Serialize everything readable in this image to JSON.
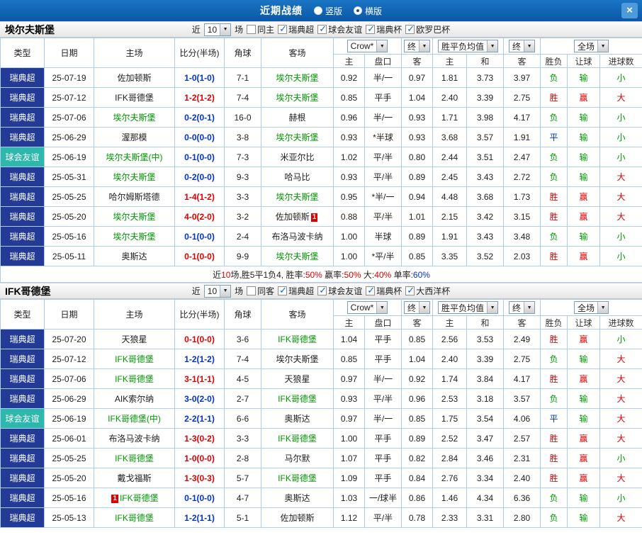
{
  "titlebar": {
    "title": "近期战绩",
    "radios": [
      {
        "label": "竖版",
        "selected": false
      },
      {
        "label": "横版",
        "selected": true
      }
    ],
    "close": "×"
  },
  "columns": {
    "type": "类型",
    "date": "日期",
    "home": "主场",
    "score": "比分(半场)",
    "corner": "角球",
    "away": "客场",
    "sub": [
      "主",
      "盘口",
      "客",
      "主",
      "和",
      "客",
      "胜负",
      "让球",
      "进球数"
    ]
  },
  "colors": {
    "topbar": "#0e62ae",
    "league_navy": "#233a97",
    "friendly_teal": "#2eb8ad",
    "win_red": "#dd0000",
    "loss_green": "#009900",
    "draw_blue": "#0033cc",
    "grid_line": "#aecdea"
  },
  "sections": [
    {
      "team": "埃尔夫斯堡",
      "filter": {
        "prefix": "近",
        "count": "10",
        "suffix": "场",
        "same": {
          "label": "同主",
          "checked": false
        },
        "comps": [
          {
            "label": "瑞典超",
            "checked": true
          },
          {
            "label": "球会友谊",
            "checked": true
          },
          {
            "label": "瑞典杯",
            "checked": true
          },
          {
            "label": "欧罗巴杯",
            "checked": true
          }
        ]
      },
      "dropdowns": {
        "company": "Crow*",
        "final1": "终",
        "avg": "胜平负均值",
        "final2": "终",
        "scope": "全场"
      },
      "rows": [
        {
          "type": "瑞典超",
          "tcls": "lg-a",
          "date": "25-07-19",
          "home": {
            "n": "佐加顿斯"
          },
          "score": {
            "t": "1-0(1-0)",
            "c": "b"
          },
          "corner": "7-1",
          "away": {
            "n": "埃尔夫斯堡",
            "g": true
          },
          "o1": "0.92",
          "hc": "半/一",
          "o2": "0.97",
          "m1": "1.81",
          "m2": "3.73",
          "m3": "3.97",
          "r1": [
            "负",
            "g"
          ],
          "r2": [
            "输",
            "g"
          ],
          "r3": [
            "小",
            "g"
          ]
        },
        {
          "type": "瑞典超",
          "tcls": "lg-a",
          "date": "25-07-12",
          "home": {
            "n": "IFK哥德堡"
          },
          "score": {
            "t": "1-2(1-2)",
            "c": "r"
          },
          "corner": "7-4",
          "away": {
            "n": "埃尔夫斯堡",
            "g": true
          },
          "o1": "0.85",
          "hc": "平手",
          "o2": "1.04",
          "m1": "2.40",
          "m2": "3.39",
          "m3": "2.75",
          "r1": [
            "胜",
            "r"
          ],
          "r2": [
            "赢",
            "r"
          ],
          "r3": [
            "大",
            "r"
          ]
        },
        {
          "type": "瑞典超",
          "tcls": "lg-a",
          "date": "25-07-06",
          "home": {
            "n": "埃尔夫斯堡",
            "g": true
          },
          "score": {
            "t": "0-2(0-1)",
            "c": "b"
          },
          "corner": "16-0",
          "away": {
            "n": "赫根"
          },
          "o1": "0.96",
          "hc": "半/一",
          "o2": "0.93",
          "m1": "1.71",
          "m2": "3.98",
          "m3": "4.17",
          "r1": [
            "负",
            "g"
          ],
          "r2": [
            "输",
            "g"
          ],
          "r3": [
            "小",
            "g"
          ]
        },
        {
          "type": "瑞典超",
          "tcls": "lg-a",
          "date": "25-06-29",
          "home": {
            "n": "渥那模"
          },
          "score": {
            "t": "0-0(0-0)",
            "c": "b"
          },
          "corner": "3-8",
          "away": {
            "n": "埃尔夫斯堡",
            "g": true
          },
          "o1": "0.93",
          "hc": "*半球",
          "o2": "0.93",
          "m1": "3.68",
          "m2": "3.57",
          "m3": "1.91",
          "r1": [
            "平",
            "b"
          ],
          "r2": [
            "输",
            "g"
          ],
          "r3": [
            "小",
            "g"
          ]
        },
        {
          "type": "球会友谊",
          "tcls": "lg-b",
          "date": "25-06-19",
          "home": {
            "n": "埃尔夫斯堡(中)",
            "g": true
          },
          "score": {
            "t": "0-1(0-0)",
            "c": "b"
          },
          "corner": "7-3",
          "away": {
            "n": "米亚尔比"
          },
          "o1": "1.02",
          "hc": "平/半",
          "o2": "0.80",
          "m1": "2.44",
          "m2": "3.51",
          "m3": "2.47",
          "r1": [
            "负",
            "g"
          ],
          "r2": [
            "输",
            "g"
          ],
          "r3": [
            "小",
            "g"
          ]
        },
        {
          "type": "瑞典超",
          "tcls": "lg-a",
          "date": "25-05-31",
          "home": {
            "n": "埃尔夫斯堡",
            "g": true
          },
          "score": {
            "t": "0-2(0-0)",
            "c": "b"
          },
          "corner": "9-3",
          "away": {
            "n": "哈马比"
          },
          "o1": "0.93",
          "hc": "平/半",
          "o2": "0.89",
          "m1": "2.45",
          "m2": "3.43",
          "m3": "2.72",
          "r1": [
            "负",
            "g"
          ],
          "r2": [
            "输",
            "g"
          ],
          "r3": [
            "大",
            "r"
          ]
        },
        {
          "type": "瑞典超",
          "tcls": "lg-a",
          "date": "25-05-25",
          "home": {
            "n": "哈尔姆斯塔德"
          },
          "score": {
            "t": "1-4(1-2)",
            "c": "r"
          },
          "corner": "3-3",
          "away": {
            "n": "埃尔夫斯堡",
            "g": true
          },
          "o1": "0.95",
          "hc": "*半/一",
          "o2": "0.94",
          "m1": "4.48",
          "m2": "3.68",
          "m3": "1.73",
          "r1": [
            "胜",
            "r"
          ],
          "r2": [
            "赢",
            "r"
          ],
          "r3": [
            "大",
            "r"
          ]
        },
        {
          "type": "瑞典超",
          "tcls": "lg-a",
          "date": "25-05-20",
          "home": {
            "n": "埃尔夫斯堡",
            "g": true
          },
          "score": {
            "t": "4-0(2-0)",
            "c": "r"
          },
          "corner": "3-2",
          "away": {
            "n": "佐加顿斯",
            "b2": "1"
          },
          "o1": "0.88",
          "hc": "平/半",
          "o2": "1.01",
          "m1": "2.15",
          "m2": "3.42",
          "m3": "3.15",
          "r1": [
            "胜",
            "r"
          ],
          "r2": [
            "赢",
            "r"
          ],
          "r3": [
            "大",
            "r"
          ]
        },
        {
          "type": "瑞典超",
          "tcls": "lg-a",
          "date": "25-05-16",
          "home": {
            "n": "埃尔夫斯堡",
            "g": true
          },
          "score": {
            "t": "0-1(0-0)",
            "c": "b"
          },
          "corner": "2-4",
          "away": {
            "n": "布洛马波卡纳"
          },
          "o1": "1.00",
          "hc": "半球",
          "o2": "0.89",
          "m1": "1.91",
          "m2": "3.43",
          "m3": "3.48",
          "r1": [
            "负",
            "g"
          ],
          "r2": [
            "输",
            "g"
          ],
          "r3": [
            "小",
            "g"
          ]
        },
        {
          "type": "瑞典超",
          "tcls": "lg-a",
          "date": "25-05-11",
          "home": {
            "n": "奥斯达"
          },
          "score": {
            "t": "0-1(0-0)",
            "c": "r"
          },
          "corner": "9-9",
          "away": {
            "n": "埃尔夫斯堡",
            "g": true
          },
          "o1": "1.00",
          "hc": "*平/半",
          "o2": "0.85",
          "m1": "3.35",
          "m2": "3.52",
          "m3": "2.03",
          "r1": [
            "胜",
            "r"
          ],
          "r2": [
            "赢",
            "r"
          ],
          "r3": [
            "小",
            "g"
          ]
        }
      ],
      "summary": [
        [
          "近",
          "k"
        ],
        [
          "10",
          "r"
        ],
        [
          "场,胜5平1负4, 胜率:",
          "k"
        ],
        [
          "50%",
          "r"
        ],
        [
          " 赢率:",
          "k"
        ],
        [
          "50%",
          "r"
        ],
        [
          " 大:",
          "k"
        ],
        [
          "40%",
          "r"
        ],
        [
          " 单率:",
          "k"
        ],
        [
          "60%",
          "b"
        ]
      ]
    },
    {
      "team": "IFK哥德堡",
      "filter": {
        "prefix": "近",
        "count": "10",
        "suffix": "场",
        "same": {
          "label": "同客",
          "checked": false
        },
        "comps": [
          {
            "label": "瑞典超",
            "checked": true
          },
          {
            "label": "球会友谊",
            "checked": true
          },
          {
            "label": "瑞典杯",
            "checked": true
          },
          {
            "label": "大西洋杯",
            "checked": true
          }
        ]
      },
      "dropdowns": {
        "company": "Crow*",
        "final1": "终",
        "avg": "胜平负均值",
        "final2": "终",
        "scope": "全场"
      },
      "rows": [
        {
          "type": "瑞典超",
          "tcls": "lg-a",
          "date": "25-07-20",
          "home": {
            "n": "天狼星"
          },
          "score": {
            "t": "0-1(0-0)",
            "c": "r"
          },
          "corner": "3-6",
          "away": {
            "n": "IFK哥德堡",
            "g": true
          },
          "o1": "1.04",
          "hc": "平手",
          "o2": "0.85",
          "m1": "2.56",
          "m2": "3.53",
          "m3": "2.49",
          "r1": [
            "胜",
            "r"
          ],
          "r2": [
            "赢",
            "r"
          ],
          "r3": [
            "小",
            "g"
          ]
        },
        {
          "type": "瑞典超",
          "tcls": "lg-a",
          "date": "25-07-12",
          "home": {
            "n": "IFK哥德堡",
            "g": true
          },
          "score": {
            "t": "1-2(1-2)",
            "c": "b"
          },
          "corner": "7-4",
          "away": {
            "n": "埃尔夫斯堡"
          },
          "o1": "0.85",
          "hc": "平手",
          "o2": "1.04",
          "m1": "2.40",
          "m2": "3.39",
          "m3": "2.75",
          "r1": [
            "负",
            "g"
          ],
          "r2": [
            "输",
            "g"
          ],
          "r3": [
            "大",
            "r"
          ]
        },
        {
          "type": "瑞典超",
          "tcls": "lg-a",
          "date": "25-07-06",
          "home": {
            "n": "IFK哥德堡",
            "g": true
          },
          "score": {
            "t": "3-1(1-1)",
            "c": "r"
          },
          "corner": "4-5",
          "away": {
            "n": "天狼星"
          },
          "o1": "0.97",
          "hc": "半/一",
          "o2": "0.92",
          "m1": "1.74",
          "m2": "3.84",
          "m3": "4.17",
          "r1": [
            "胜",
            "r"
          ],
          "r2": [
            "赢",
            "r"
          ],
          "r3": [
            "大",
            "r"
          ]
        },
        {
          "type": "瑞典超",
          "tcls": "lg-a",
          "date": "25-06-29",
          "home": {
            "n": "AIK索尔纳"
          },
          "score": {
            "t": "3-0(2-0)",
            "c": "b"
          },
          "corner": "2-7",
          "away": {
            "n": "IFK哥德堡",
            "g": true
          },
          "o1": "0.93",
          "hc": "平/半",
          "o2": "0.96",
          "m1": "2.53",
          "m2": "3.18",
          "m3": "3.57",
          "r1": [
            "负",
            "g"
          ],
          "r2": [
            "输",
            "g"
          ],
          "r3": [
            "大",
            "r"
          ]
        },
        {
          "type": "球会友谊",
          "tcls": "lg-b",
          "date": "25-06-19",
          "home": {
            "n": "IFK哥德堡(中)",
            "g": true
          },
          "score": {
            "t": "2-2(1-1)",
            "c": "b"
          },
          "corner": "6-6",
          "away": {
            "n": "奥斯达"
          },
          "o1": "0.97",
          "hc": "半/一",
          "o2": "0.85",
          "m1": "1.75",
          "m2": "3.54",
          "m3": "4.06",
          "r1": [
            "平",
            "b"
          ],
          "r2": [
            "输",
            "g"
          ],
          "r3": [
            "大",
            "r"
          ]
        },
        {
          "type": "瑞典超",
          "tcls": "lg-a",
          "date": "25-06-01",
          "home": {
            "n": "布洛马波卡纳"
          },
          "score": {
            "t": "1-3(0-2)",
            "c": "r"
          },
          "corner": "3-3",
          "away": {
            "n": "IFK哥德堡",
            "g": true
          },
          "o1": "1.00",
          "hc": "平手",
          "o2": "0.89",
          "m1": "2.52",
          "m2": "3.47",
          "m3": "2.57",
          "r1": [
            "胜",
            "r"
          ],
          "r2": [
            "赢",
            "r"
          ],
          "r3": [
            "大",
            "r"
          ]
        },
        {
          "type": "瑞典超",
          "tcls": "lg-a",
          "date": "25-05-25",
          "home": {
            "n": "IFK哥德堡",
            "g": true
          },
          "score": {
            "t": "1-0(0-0)",
            "c": "r"
          },
          "corner": "2-8",
          "away": {
            "n": "马尔默"
          },
          "o1": "1.07",
          "hc": "平手",
          "o2": "0.82",
          "m1": "2.84",
          "m2": "3.46",
          "m3": "2.31",
          "r1": [
            "胜",
            "r"
          ],
          "r2": [
            "赢",
            "r"
          ],
          "r3": [
            "小",
            "g"
          ]
        },
        {
          "type": "瑞典超",
          "tcls": "lg-a",
          "date": "25-05-20",
          "home": {
            "n": "戴戈福斯"
          },
          "score": {
            "t": "1-3(0-3)",
            "c": "r"
          },
          "corner": "5-7",
          "away": {
            "n": "IFK哥德堡",
            "g": true
          },
          "o1": "1.09",
          "hc": "平手",
          "o2": "0.84",
          "m1": "2.76",
          "m2": "3.34",
          "m3": "2.40",
          "r1": [
            "胜",
            "r"
          ],
          "r2": [
            "赢",
            "r"
          ],
          "r3": [
            "大",
            "r"
          ]
        },
        {
          "type": "瑞典超",
          "tcls": "lg-a",
          "date": "25-05-16",
          "home": {
            "n": "IFK哥德堡",
            "g": true,
            "b1": "1"
          },
          "score": {
            "t": "0-1(0-0)",
            "c": "b"
          },
          "corner": "4-7",
          "away": {
            "n": "奥斯达"
          },
          "o1": "1.03",
          "hc": "一/球半",
          "o2": "0.86",
          "m1": "1.46",
          "m2": "4.34",
          "m3": "6.36",
          "r1": [
            "负",
            "g"
          ],
          "r2": [
            "输",
            "g"
          ],
          "r3": [
            "小",
            "g"
          ]
        },
        {
          "type": "瑞典超",
          "tcls": "lg-a",
          "date": "25-05-13",
          "home": {
            "n": "IFK哥德堡",
            "g": true
          },
          "score": {
            "t": "1-2(1-1)",
            "c": "b"
          },
          "corner": "5-1",
          "away": {
            "n": "佐加顿斯"
          },
          "o1": "1.12",
          "hc": "平/半",
          "o2": "0.78",
          "m1": "2.33",
          "m2": "3.31",
          "m3": "2.80",
          "r1": [
            "负",
            "g"
          ],
          "r2": [
            "输",
            "g"
          ],
          "r3": [
            "大",
            "r"
          ]
        }
      ]
    }
  ]
}
